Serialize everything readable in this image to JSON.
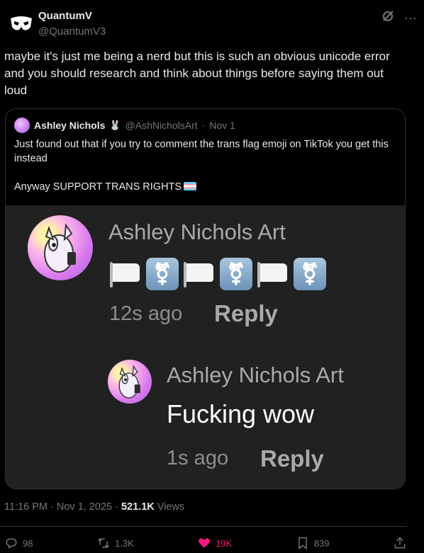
{
  "author": {
    "name": "QuantumV",
    "handle": "@QuantumV3"
  },
  "tweet": {
    "text": "maybe it's just me being a nerd but this is such an obvious unicode error and you should research and think about things before saying them out loud",
    "time": "11:16 PM · Nov 1, 2025",
    "views_count": "521.1K",
    "views_label": "Views"
  },
  "quote": {
    "name": "Ashley Nichols",
    "handle": "@AshNicholsArt",
    "date": "Nov 1",
    "line1": "Just found out that if you try to comment the trans flag emoji on TikTok you get this instead",
    "line2": "Anyway SUPPORT TRANS RIGHTS",
    "media": {
      "comment1": {
        "name": "Ashley Nichols Art",
        "time": "12s ago",
        "reply": "Reply"
      },
      "comment2": {
        "name": "Ashley Nichols Art",
        "text": "Fucking wow",
        "time": "1s ago",
        "reply": "Reply"
      }
    }
  },
  "actions": {
    "replies": "98",
    "reposts": "1.3K",
    "likes": "19K",
    "bookmarks": "839"
  },
  "colors": {
    "like": "#f91880",
    "muted": "#71767b"
  }
}
